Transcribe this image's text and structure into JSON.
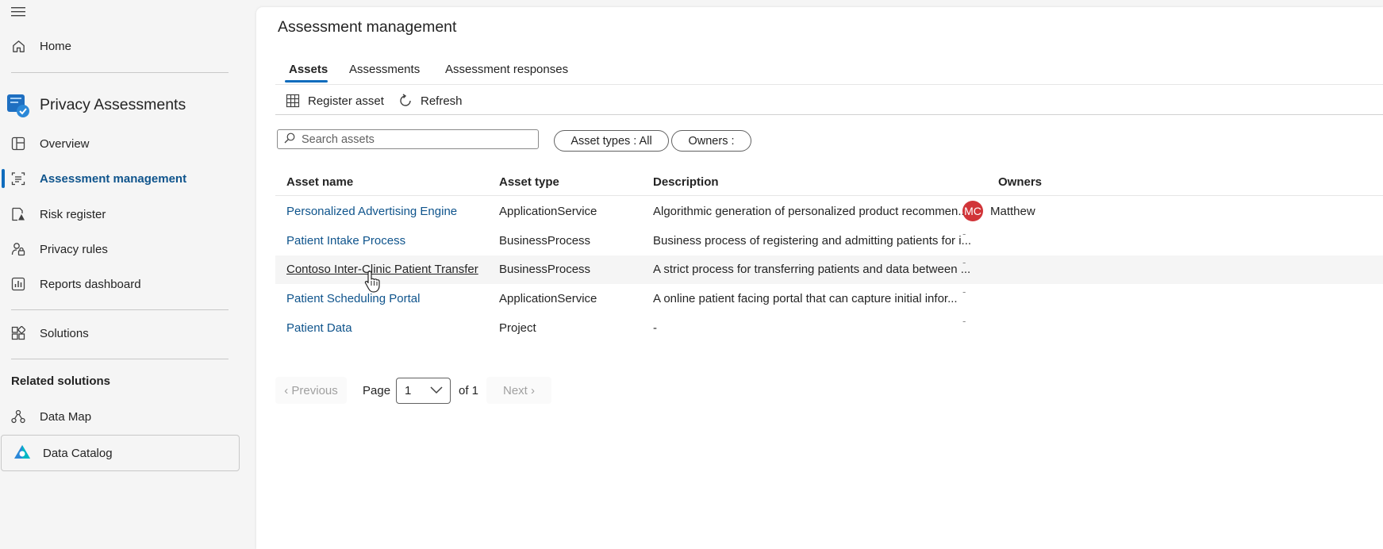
{
  "sidebar": {
    "menu_icon": "hamburger-icon",
    "home": "Home",
    "app_title": "Privacy Assessments",
    "items": [
      {
        "label": "Overview",
        "icon": "overview-icon"
      },
      {
        "label": "Assessment management",
        "icon": "assessment-icon"
      },
      {
        "label": "Risk register",
        "icon": "risk-register-icon"
      },
      {
        "label": "Privacy rules",
        "icon": "privacy-rules-icon"
      },
      {
        "label": "Reports dashboard",
        "icon": "reports-icon"
      }
    ],
    "solutions": "Solutions",
    "related_heading": "Related solutions",
    "related": [
      {
        "label": "Data Map",
        "icon": "data-map-icon"
      },
      {
        "label": "Data Catalog",
        "icon": "data-catalog-icon"
      }
    ]
  },
  "main": {
    "title": "Assessment management",
    "tabs": [
      "Assets",
      "Assessments",
      "Assessment responses"
    ],
    "toolbar": {
      "register": "Register asset",
      "refresh": "Refresh"
    },
    "search_placeholder": "Search assets",
    "filters": {
      "asset_types": "Asset types : All",
      "owners": "Owners :"
    },
    "columns": [
      "Asset name",
      "Asset type",
      "Description",
      "Owners"
    ],
    "rows": [
      {
        "name": "Personalized Advertising Engine",
        "type": "ApplicationService",
        "description": "Algorithmic generation of personalized product recommen...",
        "owner_initials": "MC",
        "owner": "Matthew"
      },
      {
        "name": "Patient Intake Process",
        "type": "BusinessProcess",
        "description": "Business process of registering and admitting patients for i...",
        "owner": "-"
      },
      {
        "name": "Contoso Inter-Clinic Patient Transfer",
        "type": "BusinessProcess",
        "description": "A strict process for transferring patients and data between ...",
        "owner": "-"
      },
      {
        "name": "Patient Scheduling Portal",
        "type": "ApplicationService",
        "description": "A online patient facing portal that can capture initial infor...",
        "owner": "-"
      },
      {
        "name": "Patient Data",
        "type": "Project",
        "description": "-",
        "owner": "-"
      }
    ],
    "pagination": {
      "previous": "‹ Previous",
      "page_label": "Page",
      "page_value": "1",
      "of_label": "of 1",
      "next": "Next ›"
    }
  },
  "colors": {
    "accent": "#0f6cbd",
    "link": "#0f548c",
    "avatar": "#d13438"
  }
}
